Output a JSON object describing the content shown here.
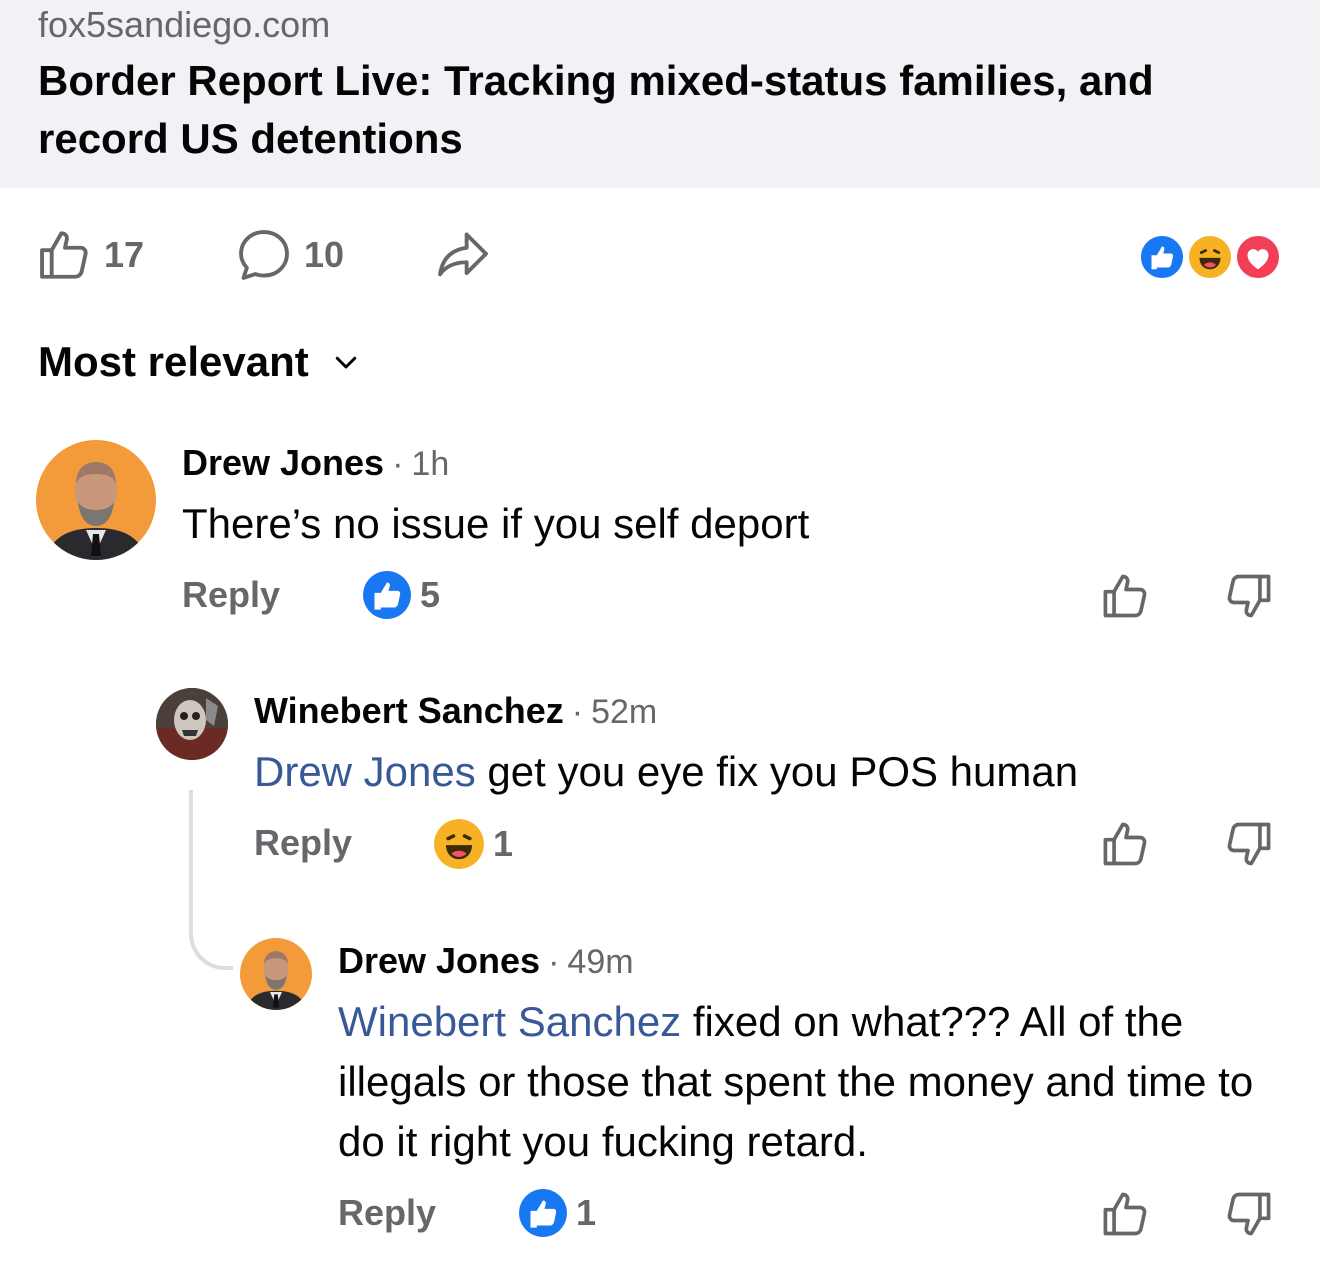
{
  "link_card": {
    "domain": "fox5sandiego.com",
    "title": "Border Report Live: Tracking mixed-status families, and record US detentions"
  },
  "post_actions": {
    "like_count": "17",
    "comment_count": "10",
    "reactions": [
      "like",
      "haha",
      "love"
    ]
  },
  "sort": {
    "label": "Most relevant"
  },
  "comments": [
    {
      "author": "Drew Jones",
      "time": "1h",
      "mention": "",
      "text": "There’s no issue if you self deport",
      "reply_label": "Reply",
      "reaction": "like",
      "reaction_count": "5"
    },
    {
      "author": "Winebert Sanchez",
      "time": "52m",
      "mention": "Drew Jones",
      "text": " get you eye fix you POS human",
      "reply_label": "Reply",
      "reaction": "haha",
      "reaction_count": "1"
    },
    {
      "author": "Drew Jones",
      "time": "49m",
      "mention": "Winebert Sanchez",
      "text": " fixed on what??? All of the illegals or those that spent the money and time to do it right you fucking retard.",
      "reply_label": "Reply",
      "reaction": "like",
      "reaction_count": "1"
    }
  ],
  "colors": {
    "like_blue": "#1877f2",
    "love_red": "#f33e58",
    "haha_yellow": "#f7b125",
    "mention_blue": "#385898",
    "muted_gray": "#65676b"
  }
}
